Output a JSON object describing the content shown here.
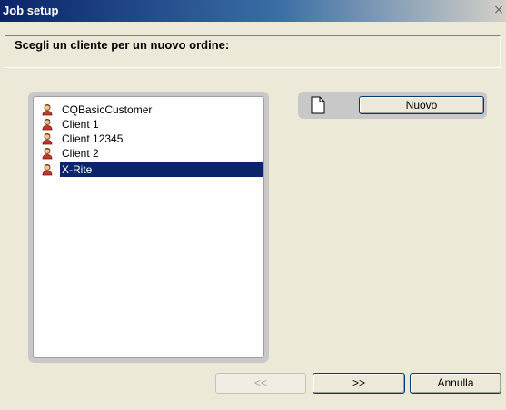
{
  "window": {
    "title": "Job setup",
    "close_glyph": "×"
  },
  "header": {
    "prompt": "Scegli un cliente per un nuovo ordine:"
  },
  "customers": {
    "items": [
      {
        "label": "CQBasicCustomer",
        "icon": "customer-icon",
        "selected": false
      },
      {
        "label": "Client 1",
        "icon": "customer-icon",
        "selected": false
      },
      {
        "label": "Client 12345",
        "icon": "customer-icon",
        "selected": false
      },
      {
        "label": "Client 2",
        "icon": "customer-icon",
        "selected": false
      },
      {
        "label": "X-Rite",
        "icon": "customer-icon",
        "selected": true
      }
    ]
  },
  "new_panel": {
    "icon": "document-icon",
    "button_label": "Nuovo"
  },
  "footer": {
    "back_label": "<<",
    "back_enabled": false,
    "next_label": ">>",
    "cancel_label": "Annulla"
  },
  "colors": {
    "title_bar": "#0a246a",
    "selection": "#0a246a",
    "window_bg": "#ece9d8",
    "panel_gray": "#c8c8c8"
  }
}
